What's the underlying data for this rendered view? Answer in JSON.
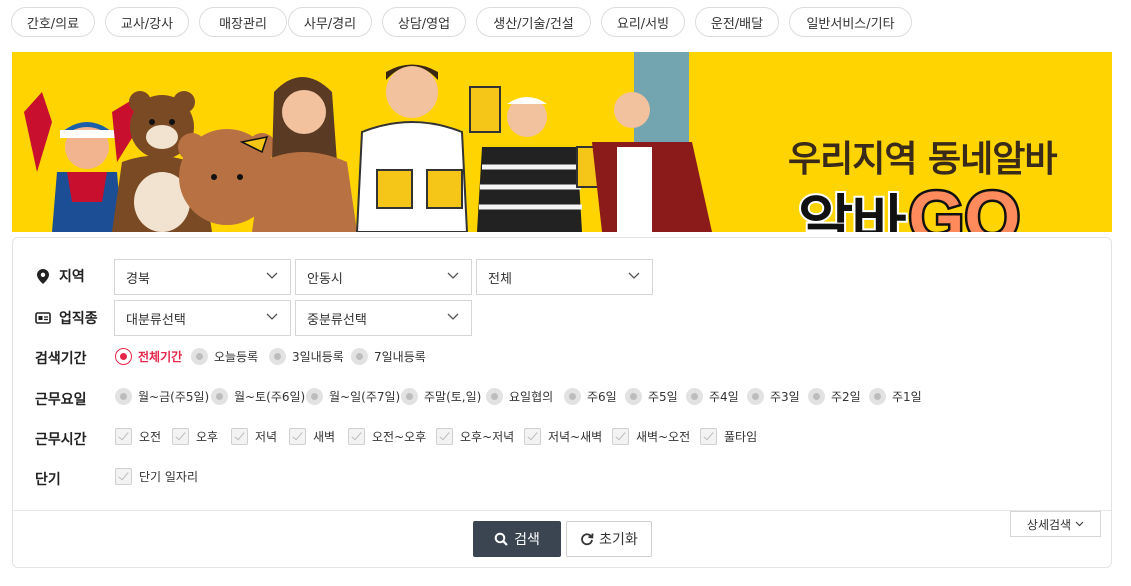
{
  "categories": [
    "간호/의료",
    "교사/강사",
    "매장관리",
    "사무/경리",
    "상담/영업",
    "생산/기술/건설",
    "요리/서빙",
    "운전/배달",
    "일반서비스/기타"
  ],
  "banner": {
    "subtitle": "우리지역 동네알바",
    "title_part1": "알바",
    "title_part2": "GO"
  },
  "filters": {
    "region": {
      "label": "지역",
      "icon": "map-pin-icon",
      "selects": [
        "경북",
        "안동시",
        "전체"
      ]
    },
    "industry": {
      "label": "업직종",
      "icon": "id-card-icon",
      "selects": [
        "대분류선택",
        "중분류선택"
      ]
    },
    "period": {
      "label": "검색기간",
      "options": [
        "전체기간",
        "오늘등록",
        "3일내등록",
        "7일내등록"
      ],
      "selected": "전체기간"
    },
    "workdays": {
      "label": "근무요일",
      "options": [
        "월~금(주5일)",
        "월~토(주6일)",
        "월~일(주7일)",
        "주말(토,일)",
        "요일협의",
        "주6일",
        "주5일",
        "주4일",
        "주3일",
        "주2일",
        "주1일"
      ]
    },
    "worktime": {
      "label": "근무시간",
      "options": [
        "오전",
        "오후",
        "저녁",
        "새벽",
        "오전~오후",
        "오후~저녁",
        "저녁~새벽",
        "새벽~오전",
        "풀타임"
      ]
    },
    "shortterm": {
      "label": "단기",
      "options": [
        "단기 일자리"
      ]
    }
  },
  "buttons": {
    "search": "검색",
    "reset": "초기화",
    "detail": "상세검색"
  },
  "colors": {
    "banner_bg": "#ffd400",
    "accent_red": "#e8264a",
    "search_btn": "#3b4551",
    "go_orange": "#ff8a5c"
  }
}
